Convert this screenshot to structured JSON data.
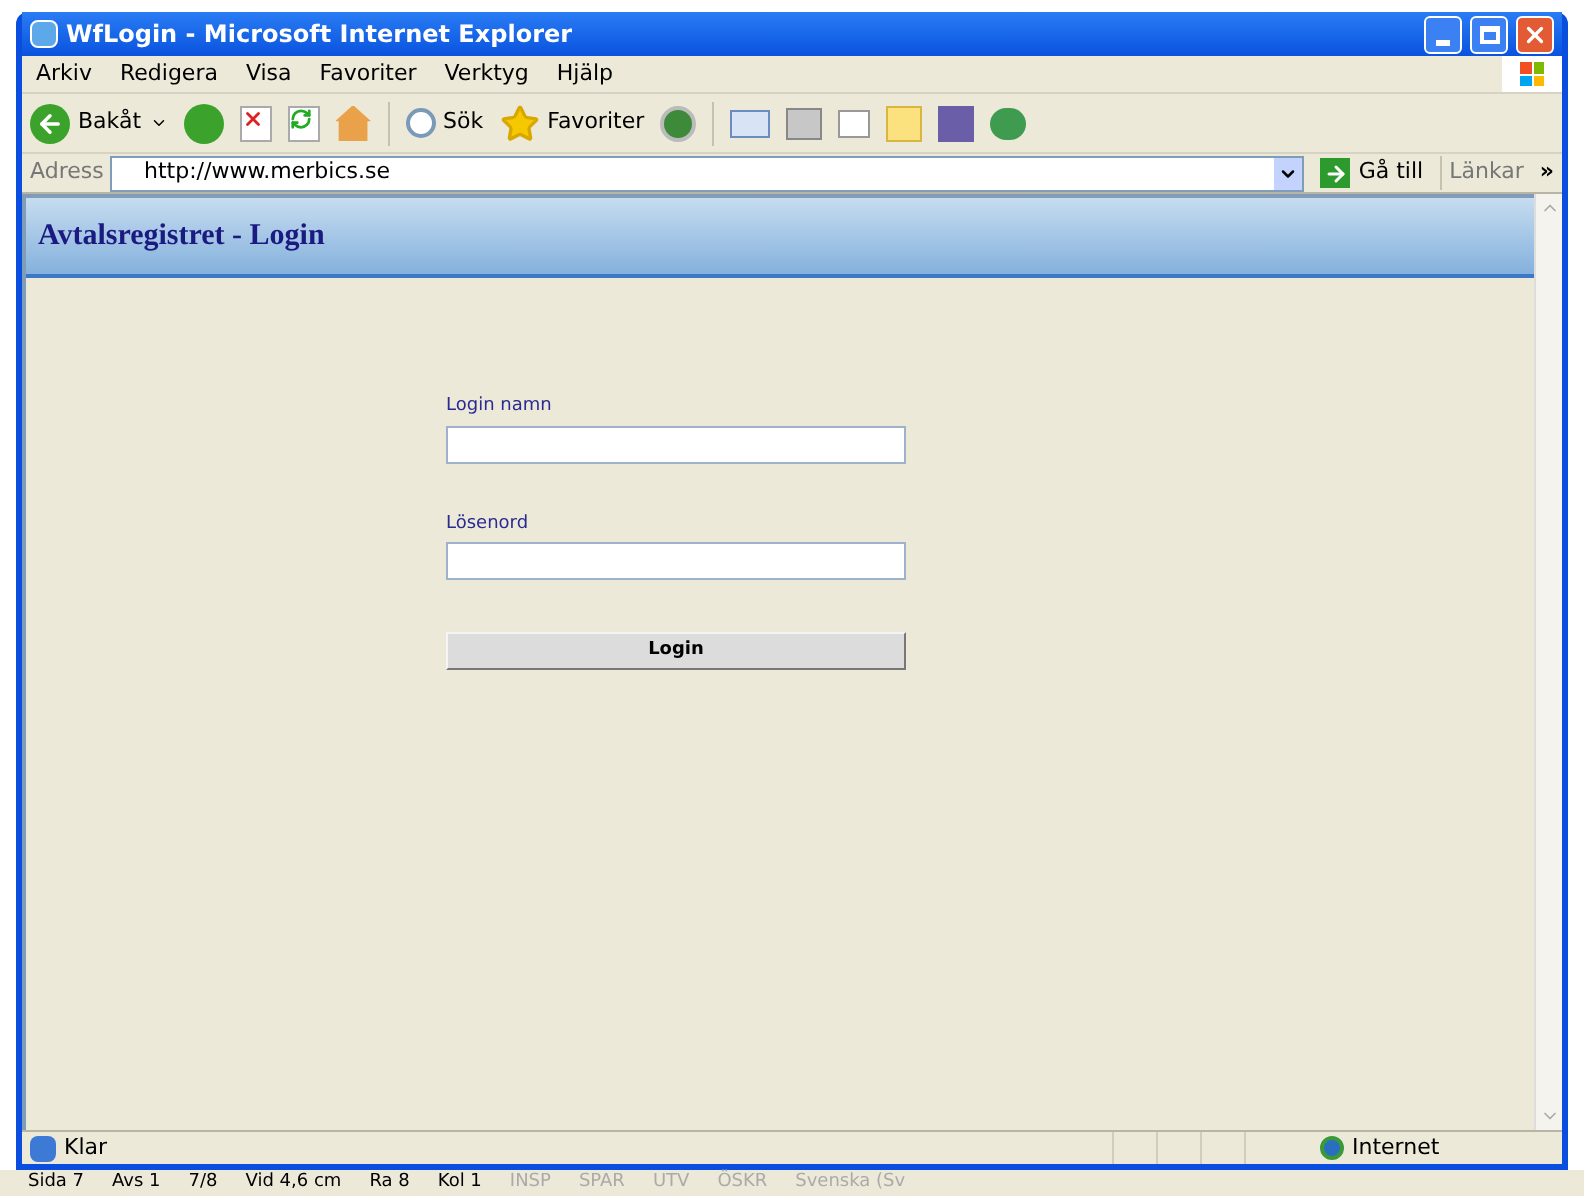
{
  "window": {
    "title": "WfLogin - Microsoft Internet Explorer"
  },
  "menu": [
    "Arkiv",
    "Redigera",
    "Visa",
    "Favoriter",
    "Verktyg",
    "Hjälp"
  ],
  "toolbar": {
    "back": "Bakåt",
    "search": "Sök",
    "favorites": "Favoriter"
  },
  "address_bar": {
    "label": "Adress",
    "value": "http://www.merbics.se",
    "go": "Gå till",
    "links": "Länkar",
    "more": "»"
  },
  "page": {
    "heading": "Avtalsregistret - Login",
    "fields": [
      {
        "label": "Login namn"
      },
      {
        "label": "Lösenord"
      }
    ],
    "button": "Login"
  },
  "status_bar": {
    "text": "Klar",
    "zone": "Internet"
  },
  "word_status_bar": [
    "Sida 7",
    "Avs 1",
    "7/8",
    "Vid 4,6 cm",
    "Ra 8",
    "Kol 1",
    "INSP",
    "SPAR",
    "UTV",
    "ÖSKR",
    "Svenska (Sv"
  ]
}
